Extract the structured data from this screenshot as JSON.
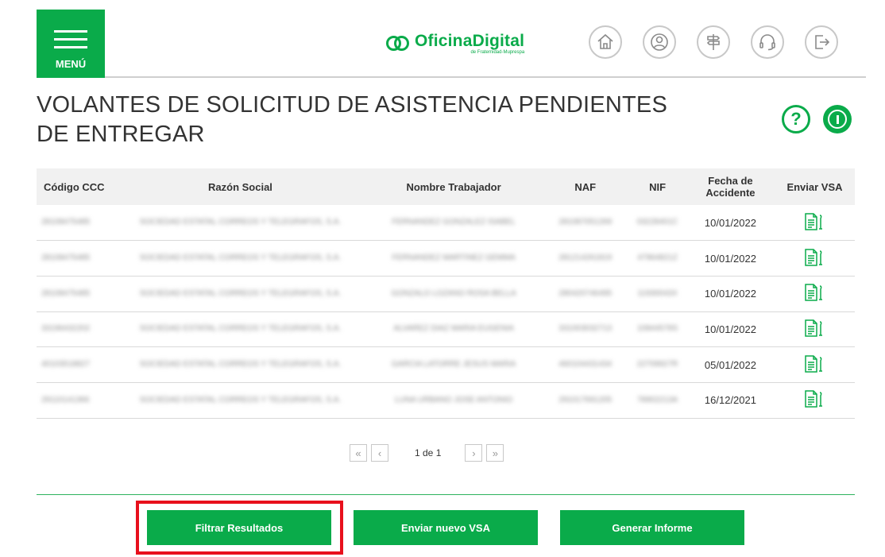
{
  "header": {
    "menu_label": "MENÚ",
    "logo_main": "OficinaDigital",
    "logo_sub": "de Fraternidad-Muprespa",
    "icons": [
      "home-icon",
      "user-icon",
      "signpost-icon",
      "headset-icon",
      "logout-icon"
    ]
  },
  "page": {
    "title": "VOLANTES DE SOLICITUD DE ASISTENCIA PENDIENTES DE ENTREGAR",
    "help_label": "?"
  },
  "table": {
    "columns": [
      "Código CCC",
      "Razón Social",
      "Nombre Trabajador",
      "NAF",
      "NIF",
      "Fecha de Accidente",
      "Enviar VSA"
    ],
    "rows": [
      {
        "ccc": "28108475485",
        "razon": "SOCIEDAD ESTATAL CORREOS Y TELEGRAFOS, S.A.",
        "nombre": "FERNANDEZ GONZALEZ ISABEL",
        "naf": "281087051269",
        "nif": "03228401C",
        "fecha": "10/01/2022"
      },
      {
        "ccc": "28108475485",
        "razon": "SOCIEDAD ESTATAL CORREOS Y TELEGRAFOS, S.A.",
        "nombre": "FERNANDEZ MARTINEZ GEMMA",
        "naf": "281214261819",
        "nif": "47964821Z",
        "fecha": "10/01/2022"
      },
      {
        "ccc": "28108475485",
        "razon": "SOCIEDAD ESTATAL CORREOS Y TELEGRAFOS, S.A.",
        "nombre": "GONZALO LOZANO ROSA BELLA",
        "naf": "280420746495",
        "nif": "11930043X",
        "fecha": "10/01/2022"
      },
      {
        "ccc": "33196432202",
        "razon": "SOCIEDAD ESTATAL CORREOS Y TELEGRAFOS, S.A.",
        "nombre": "ALVAREZ DIAZ MARIA EUGENIA",
        "naf": "331003032713",
        "nif": "10844578S",
        "fecha": "10/01/2022"
      },
      {
        "ccc": "40103518827",
        "razon": "SOCIEDAD ESTATAL CORREOS Y TELEGRAFOS, S.A.",
        "nombre": "GARCIA LATORRE JESUS MARIA",
        "naf": "460104431434",
        "nif": "22709927R",
        "fecha": "05/01/2022"
      },
      {
        "ccc": "29110141366",
        "razon": "SOCIEDAD ESTATAL CORREOS Y TELEGRAFOS, S.A.",
        "nombre": "LUNA URBANO JOSE ANTONIO",
        "naf": "291017691205",
        "nif": "78902213A",
        "fecha": "16/12/2021"
      }
    ]
  },
  "pagination": {
    "first": "«",
    "prev": "‹",
    "text": "1 de 1",
    "next": "›",
    "last": "»"
  },
  "buttons": {
    "filtrar": "Filtrar Resultados",
    "enviar": "Enviar nuevo VSA",
    "informe": "Generar Informe"
  },
  "colors": {
    "brand_green": "#0aab4a",
    "highlight_red": "#e8101c"
  }
}
